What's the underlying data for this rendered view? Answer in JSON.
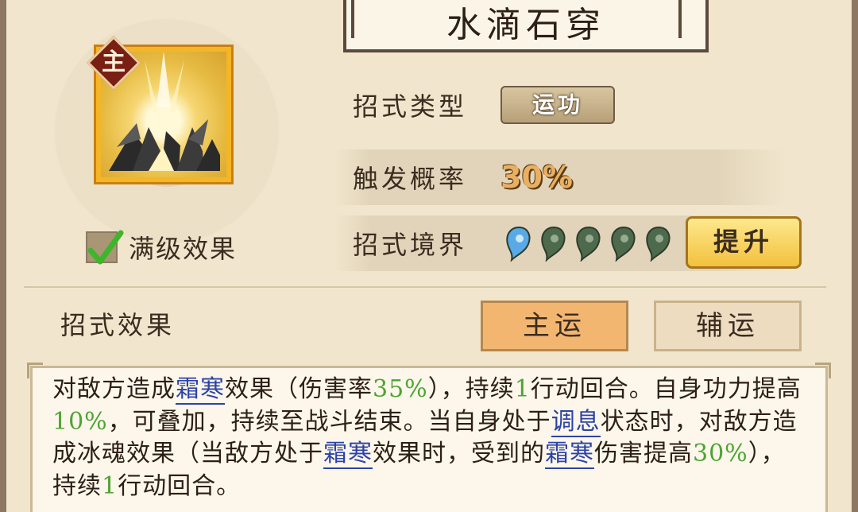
{
  "skill": {
    "name": "水滴石穿",
    "badge": "主",
    "max_level_label": "满级效果",
    "max_level_checked": true
  },
  "info": {
    "type_label": "招式类型",
    "type_value": "运功",
    "rate_label": "触发概率",
    "rate_value": "30%",
    "realm_label": "招式境界",
    "realm_total": 5,
    "realm_filled": 1,
    "upgrade_label": "提升"
  },
  "effect": {
    "section_label": "招式效果",
    "tabs": [
      {
        "label": "主运",
        "active": true
      },
      {
        "label": "辅运",
        "active": false
      }
    ],
    "segments": [
      {
        "t": "对敌方造成",
        "s": "n"
      },
      {
        "t": "霜寒",
        "s": "b"
      },
      {
        "t": "效果（伤害率",
        "s": "n"
      },
      {
        "t": "35%",
        "s": "g"
      },
      {
        "t": "），持续",
        "s": "n"
      },
      {
        "t": "1",
        "s": "g"
      },
      {
        "t": "行动回合。自身功力提高",
        "s": "n"
      },
      {
        "t": "10%",
        "s": "g"
      },
      {
        "t": "，可叠加，持续至战斗结束。当自身处于",
        "s": "n"
      },
      {
        "t": "调息",
        "s": "b"
      },
      {
        "t": "状态时，对敌方造成冰魂效果（当敌方处于",
        "s": "n"
      },
      {
        "t": "霜寒",
        "s": "b"
      },
      {
        "t": "效果时，受到的",
        "s": "n"
      },
      {
        "t": "霜寒",
        "s": "b"
      },
      {
        "t": "伤害提高",
        "s": "n"
      },
      {
        "t": "30%",
        "s": "g"
      },
      {
        "t": "），持续",
        "s": "n"
      },
      {
        "t": "1",
        "s": "g"
      },
      {
        "t": "行动回合。",
        "s": "n"
      }
    ]
  },
  "colors": {
    "highlight_green": "#4ea434",
    "keyword_blue": "#2d43a6",
    "active_tab": "#f3b671",
    "gold_button": "#f3c13d",
    "realm_active": "#58a9e6",
    "realm_inactive": "#4e6a4c"
  }
}
